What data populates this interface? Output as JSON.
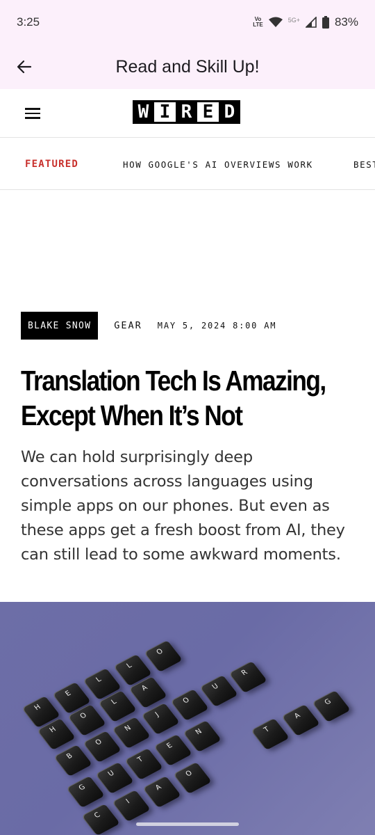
{
  "status_bar": {
    "time": "3:25",
    "volte": "Vo LTE",
    "network": "5G+",
    "battery": "83%"
  },
  "app_bar": {
    "title": "Read and Skill Up!",
    "back_icon": "arrow-back-icon"
  },
  "site": {
    "logo_letters": [
      "W",
      "I",
      "R",
      "E",
      "D"
    ],
    "menu_icon": "hamburger-menu-icon"
  },
  "nav": {
    "items": [
      "FEATURED",
      "HOW GOOGLE'S AI OVERVIEWS WORK",
      "BEST"
    ]
  },
  "article": {
    "author": "BLAKE SNOW",
    "category": "GEAR",
    "date": "MAY 5, 2024 8:00 AM",
    "headline": "Translation Tech Is Amazing, Except When It’s Not",
    "dek": "We can hold surprisingly deep conversations across languages using simple apps on our phones. But even as these apps get a fresh boost from AI, they can still lead to some awkward moments."
  },
  "hero_keys": {
    "row1": [
      "H",
      "E",
      "L",
      "L",
      "O"
    ],
    "row2": [
      "H",
      "O",
      "L",
      "A"
    ],
    "row3": [
      "B",
      "O",
      "N",
      "J",
      "O",
      "U",
      "R"
    ],
    "row4": [
      "G",
      "U",
      "T",
      "E",
      "N"
    ],
    "row5": [
      "T",
      "A",
      "G"
    ],
    "row6": [
      "C",
      "I",
      "A",
      "O"
    ]
  },
  "colors": {
    "status_bg": "#fcf0fb",
    "featured": "#c8302c",
    "hero_bg": "#6d6ea7"
  }
}
